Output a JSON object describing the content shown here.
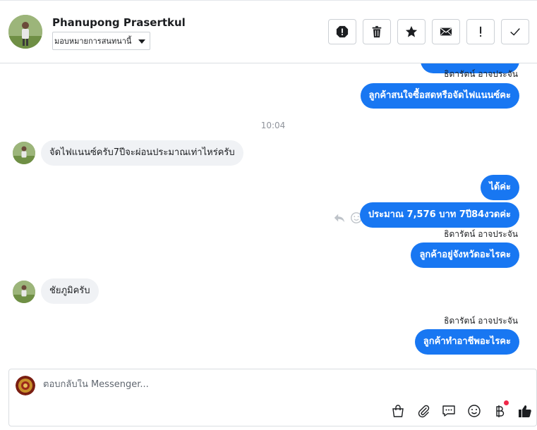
{
  "header": {
    "contact_name": "Phanupong Prasertkul",
    "assign_label": "มอบหมายการสนทนานี้",
    "actions": [
      {
        "name": "spam-icon"
      },
      {
        "name": "trash-icon"
      },
      {
        "name": "star-icon"
      },
      {
        "name": "envelope-icon"
      },
      {
        "name": "exclamation-icon"
      },
      {
        "name": "checkmark-icon"
      }
    ]
  },
  "messages": {
    "sender1": "ธิดารัตน์ อาจประจัน",
    "out1": "ลูกค้าสนใจซื้อสดหรือจัดไฟแนนซ์คะ",
    "time": "10:04",
    "in1": "จัดไฟแนนซ์ครับ7ปีจะผ่อนประมาณเท่าไหร่ครับ",
    "out2": "ได้ค่ะ",
    "out3": "ประมาณ 7,576 บาท 7ปี84งวดค่ะ",
    "sender2": "ธิดารัตน์ อาจประจัน",
    "out4": "ลูกค้าอยู่จังหวัดอะไรคะ",
    "in2": "ชัยภูมิครับ",
    "sender3": "ธิดารัตน์ อาจประจัน",
    "out5": "ลูกค้าทำอาชีพอะไรคะ"
  },
  "composer": {
    "placeholder": "ตอบกลับใน Messenger...",
    "tools": [
      "shopping-bag-icon",
      "paperclip-icon",
      "chat-bubble-icon",
      "emoji-icon",
      "baht-icon",
      "thumbs-up-icon"
    ]
  },
  "colors": {
    "accent": "#1877f2",
    "incoming": "#f0f2f5",
    "notification_dot": "#f02849"
  }
}
